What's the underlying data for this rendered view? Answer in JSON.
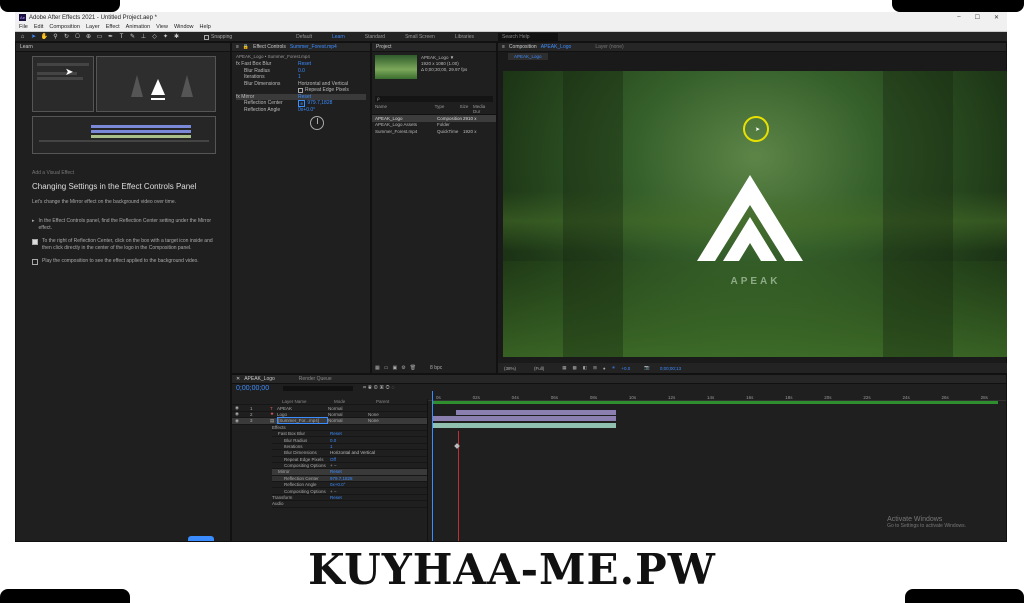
{
  "window_title": "Adobe After Effects 2021 - Untitled Project.aep *",
  "app_icon": "Ae",
  "window_controls": [
    "–",
    "☐",
    "✕"
  ],
  "menu": [
    "File",
    "Edit",
    "Composition",
    "Layer",
    "Effect",
    "Animation",
    "View",
    "Window",
    "Help"
  ],
  "toolbar": {
    "snapping_label": "Snapping",
    "workspaces": [
      "Default",
      "Learn",
      "Standard",
      "Small Screen",
      "Libraries"
    ],
    "active_workspace": "Learn",
    "search_placeholder": "Search Help"
  },
  "learn_panel": {
    "tab": "Learn",
    "lesson_label": "Add a Visual Effect",
    "title": "Changing Settings in the Effect Controls Panel",
    "intro": "Let's change the Mirror effect on the background video over time.",
    "step1": "In the Effect Controls panel, find the Reflection Center setting under the Mirror effect.",
    "step2": "To the right of Reflection Center, click on the box with a target icon inside and then click directly in the center of the logo in the Composition panel.",
    "step3": "Play the composition to see the effect applied to the background video."
  },
  "effect_controls": {
    "tab_label": "Effect Controls",
    "tab_layer": "Summer_Forest.mp4",
    "path": "APEAK_Logo • Summer_Forest.mp4",
    "rows": [
      {
        "name": "fx  Fast Box Blur",
        "value": "Reset"
      },
      {
        "name": "Blur Radius",
        "value": "0.0"
      },
      {
        "name": "Iterations",
        "value": "1"
      },
      {
        "name": "Blur Dimensions",
        "value": "Horizontal and Vertical"
      },
      {
        "name": "",
        "value": "Repeat Edge Pixels"
      },
      {
        "name": "fx  Mirror",
        "value": "Reset"
      },
      {
        "name": "Reflection Center",
        "value": "979.7,1828"
      },
      {
        "name": "Reflection Angle",
        "value": "0x+0.0°"
      }
    ]
  },
  "project_panel": {
    "tab": "Project",
    "comp_name": "APEAK_Logo ▼",
    "comp_info1": "1920 x 1080 (1.00)",
    "comp_info2": "Δ 0;00;30;00, 29.97 fps",
    "search_placeholder": "ρ",
    "headers": [
      "Name",
      "Type",
      "Size",
      "Media Dur"
    ],
    "items": [
      {
        "name": "APEAK_Logo",
        "type": "Composition",
        "size": "2910 x"
      },
      {
        "name": "APEAK_Logo Assets",
        "type": "Folder",
        "size": ""
      },
      {
        "name": "Summer_Forest.mp4",
        "type": "QuickTime",
        "size": "1920 x"
      }
    ],
    "bpc": "8 bpc"
  },
  "composition": {
    "tab_label": "Composition",
    "tab_comp": "APEAK_Logo",
    "tab2": "Layer (none)",
    "subtab": "APEAK_Logo",
    "logo_text": "APEAK",
    "zoom": "(38%)",
    "resolution": "(Full)",
    "plus_val": "+0.0",
    "timecode": "0;00;00;13"
  },
  "timeline": {
    "tab": "APEAK_Logo",
    "render_queue": "Render Queue",
    "timecode": "0;00;00;00",
    "col_layer": "Layer Name",
    "col_mode": "Mode",
    "col_parent": "Parent",
    "layers": [
      {
        "num": "1",
        "name": "APEAK",
        "mode": "Normal",
        "parent": ""
      },
      {
        "num": "2",
        "name": "Logo",
        "mode": "Normal",
        "parent": "None"
      },
      {
        "num": "3",
        "name": "[Summer_For...mp4]",
        "mode": "Normal",
        "parent": "None"
      }
    ],
    "props": [
      {
        "name": "Effects",
        "value": ""
      },
      {
        "name": "Fast Box Blur",
        "value": "Reset"
      },
      {
        "name": "Blur Radius",
        "value": "0.0"
      },
      {
        "name": "Iterations",
        "value": "1"
      },
      {
        "name": "Blur Dimensions",
        "value": "Horizontal and Vertical"
      },
      {
        "name": "Repeat Edge Pixels",
        "value": "Off"
      },
      {
        "name": "Compositing Options",
        "value": "+ −"
      },
      {
        "name": "Mirror",
        "value": "Reset"
      },
      {
        "name": "Reflection Center",
        "value": "979.7,1828"
      },
      {
        "name": "Reflection Angle",
        "value": "0x+0.0°"
      },
      {
        "name": "Compositing Options",
        "value": "+ −"
      },
      {
        "name": "Transform",
        "value": "Reset"
      },
      {
        "name": "Audio",
        "value": ""
      }
    ],
    "ruler": [
      "0s",
      "02s",
      "04s",
      "06s",
      "08s",
      "10s",
      "12s",
      "14s",
      "16s",
      "18s",
      "20s",
      "22s",
      "24s",
      "26s",
      "28s"
    ]
  },
  "os_notice": {
    "title": "Activate Windows",
    "subtitle": "Go to Settings to activate Windows."
  },
  "watermark": "KUYHAA-ME.PW"
}
